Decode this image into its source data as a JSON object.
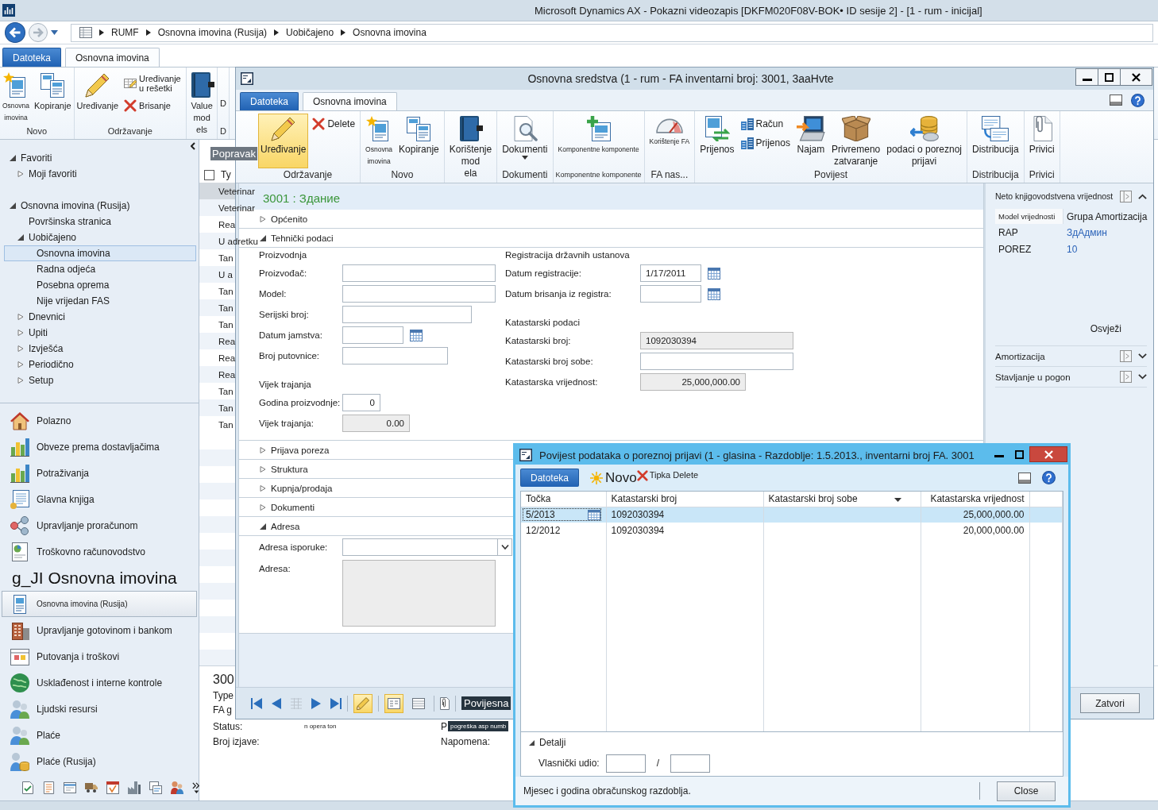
{
  "window": {
    "title": "Microsoft Dynamics AX - Pokazni videozapis [DKFM020F08V-BOK• ID sesije 2] - [1 - rum - inicijal]"
  },
  "address_bar": {
    "breadcrumb": [
      "RUMF",
      "Osnovna imovina (Rusija)",
      "Uobičajeno",
      "Osnovna imovina"
    ]
  },
  "ribbon": {
    "tabs": [
      {
        "label": "Datoteka",
        "kind": "file",
        "selected": false
      },
      {
        "label": "Osnovna imovina",
        "kind": "tab",
        "selected": true
      }
    ],
    "groups": [
      {
        "label": "Novo",
        "buttons": [
          {
            "kind": "compact",
            "label": "Osnovna\nimovina"
          },
          {
            "kind": "large",
            "label": "Kopiranje"
          }
        ]
      },
      {
        "label": "Održavanje",
        "buttons": [
          {
            "kind": "large",
            "label": "Uređivanje"
          },
          {
            "kind": "small",
            "label": "Uređivanje u rešetki"
          },
          {
            "kind": "small",
            "label": "Brisanje"
          }
        ]
      },
      {
        "buttons": [
          {
            "kind": "large",
            "label": "Value\nmod\nels"
          }
        ]
      },
      {
        "label": "D",
        "buttons": [
          {
            "kind": "large",
            "label": "D"
          }
        ]
      }
    ]
  },
  "navigation": {
    "tree": [
      {
        "label": "Favoriti",
        "expanded": true,
        "selected": false,
        "children": [
          {
            "label": "Moji favoriti",
            "expanded": false,
            "selected": false
          }
        ]
      },
      {
        "label": "Osnovna imovina (Rusija)",
        "expanded": true,
        "selected": false,
        "children": [
          {
            "label": "Površinska stranica",
            "selected": false
          },
          {
            "label": "Uobičajeno",
            "expanded": true,
            "selected": false,
            "children": [
              {
                "label": "Osnovna imovina",
                "selected": true
              },
              {
                "label": "Radna odjeća",
                "selected": false
              },
              {
                "label": "Posebna oprema",
                "selected": false
              },
              {
                "label": "Nije vrijedan FAS",
                "selected": false
              }
            ]
          },
          {
            "label": "Dnevnici",
            "expanded": false,
            "selected": false
          },
          {
            "label": "Upiti",
            "expanded": false,
            "selected": false
          },
          {
            "label": "Izvješća",
            "expanded": false,
            "selected": false
          },
          {
            "label": "Periodično",
            "expanded": false,
            "selected": false
          },
          {
            "label": "Setup",
            "expanded": false,
            "selected": false
          }
        ]
      }
    ],
    "modules": [
      {
        "kind": "module",
        "label": "Polazno",
        "selected": false
      },
      {
        "kind": "module",
        "label": "Obveze prema dostavljačima",
        "selected": false
      },
      {
        "kind": "module",
        "label": "Potraživanja",
        "selected": false
      },
      {
        "kind": "module",
        "label": "Glavna knjiga",
        "selected": false
      },
      {
        "kind": "module",
        "label": "Upravljanje proračunom",
        "selected": false
      },
      {
        "kind": "module",
        "label": "Troškovno računovodstvo",
        "selected": false
      },
      {
        "kind": "heading",
        "label": "g_JI Osnovna imovina"
      },
      {
        "kind": "module",
        "label": "Osnovna imovina (Rusija)",
        "selected": true
      },
      {
        "kind": "module",
        "label": "Upravljanje gotovinom i bankom",
        "selected": false
      },
      {
        "kind": "module",
        "label": "Putovanja i troškovi",
        "selected": false
      },
      {
        "kind": "module",
        "label": "Usklađenost i interne kontrole",
        "selected": false
      },
      {
        "kind": "module",
        "label": "Ljudski resursi",
        "selected": false
      },
      {
        "kind": "module",
        "label": "Plaće",
        "selected": false
      },
      {
        "kind": "module",
        "label": "Plaće (Rusija)",
        "selected": false
      }
    ]
  },
  "list_page": {
    "filter": "Popravak",
    "header": {
      "checked": false,
      "column": "Ty"
    },
    "rows": [
      {
        "text": "Veterinar",
        "selected": true
      },
      {
        "text": "Veterinar",
        "selected": false
      },
      {
        "text": "Rea",
        "selected": false
      },
      {
        "text": "U adretku",
        "selected": false
      },
      {
        "text": "Tan",
        "selected": false
      },
      {
        "text": "U a",
        "selected": false
      },
      {
        "text": "Tan",
        "selected": false
      },
      {
        "text": "Tan",
        "selected": false
      },
      {
        "text": "Tan",
        "selected": false
      },
      {
        "text": "Rea",
        "selected": false
      },
      {
        "text": "Rea",
        "selected": false
      },
      {
        "text": "Rea",
        "selected": false
      },
      {
        "text": "Tan",
        "selected": false
      },
      {
        "text": "Tan",
        "selected": false
      },
      {
        "text": "Tan",
        "selected": false
      }
    ],
    "details": {
      "title": "300",
      "lines": [
        "Type",
        "FA g"
      ],
      "fields": [
        {
          "label": "Status:",
          "value": "n opera ton",
          "kind": "plain"
        },
        {
          "label": "P",
          "value": "pogreška asp numb",
          "kind": "tag"
        },
        {
          "label": "Broj izjave:"
        },
        {
          "label": "Napomena:"
        }
      ]
    }
  },
  "asset_form": {
    "title": "Osnovna sredstva (1 - rum - FA inventarni broj: 3001, 3aaHvte",
    "ribbon": {
      "tabs": [
        {
          "label": "Datoteka",
          "kind": "file",
          "selected": false
        },
        {
          "label": "Osnovna imovina",
          "kind": "tab",
          "selected": true
        }
      ],
      "groups": [
        {
          "label": "Održavanje",
          "buttons": [
            {
              "kind": "large",
              "label": "Uređivanje",
              "on": true
            },
            {
              "kind": "small",
              "label": "Delete",
              "on": false
            }
          ]
        },
        {
          "label": "Novo",
          "buttons": [
            {
              "kind": "compact",
              "label": "Osnovna\nimovina"
            },
            {
              "kind": "large",
              "label": "Kopiranje"
            }
          ]
        },
        {
          "buttons": [
            {
              "kind": "large",
              "label": "Korištenje\nmod\nela"
            }
          ]
        },
        {
          "label": "Dokumenti",
          "buttons": [
            {
              "kind": "menu",
              "label": "Dokumenti"
            }
          ]
        },
        {
          "label": "Komponentne komponente",
          "buttons": [
            {
              "kind": "compact",
              "label": "Komponentne komponente"
            }
          ]
        },
        {
          "label": "FA nas...",
          "buttons": [
            {
              "kind": "compact",
              "label": "Korištenje FA"
            }
          ]
        },
        {
          "label": "Povijest",
          "buttons": [
            {
              "kind": "large",
              "label": "Prijenos"
            },
            {
              "kind": "small",
              "label": "Račun"
            },
            {
              "kind": "small",
              "label": "Prijenos"
            },
            {
              "kind": "large",
              "label": "Najam"
            },
            {
              "kind": "large",
              "label": "Privremeno\nzatvaranje"
            },
            {
              "kind": "large",
              "label": "podaci o poreznoj\nprijavi"
            }
          ]
        },
        {
          "label": "Distribucija",
          "buttons": [
            {
              "kind": "large",
              "label": "Distribucija"
            }
          ]
        },
        {
          "label": "Privici",
          "buttons": [
            {
              "kind": "large",
              "label": "Privici"
            }
          ]
        }
      ]
    },
    "header": "3001 : Здание",
    "sections": [
      {
        "title": "Općenito",
        "expanded": false
      },
      {
        "title": "Tehnički podaci",
        "expanded": true,
        "columns": [
          [
            {
              "title": "Proizvodnja",
              "fields": [
                {
                  "label": "Proizvođač:",
                  "kind": "text",
                  "editable": true
                },
                {
                  "label": "Model:",
                  "kind": "text",
                  "editable": true
                },
                {
                  "label": "Serijski broj:",
                  "kind": "text",
                  "editable": true
                },
                {
                  "label": "Datum jamstva:",
                  "kind": "date",
                  "editable": true
                },
                {
                  "label": "Broj putovnice:",
                  "kind": "text",
                  "editable": true
                }
              ]
            },
            {
              "title": "Vijek trajanja",
              "fields": [
                {
                  "label": "Godina proizvodnje:",
                  "kind": "number",
                  "editable": true,
                  "value": "0"
                },
                {
                  "label": "Vijek trajanja:",
                  "kind": "number",
                  "editable": false,
                  "value": "0.00"
                }
              ]
            }
          ],
          [
            {
              "title": "Registracija državnih ustanova",
              "fields": [
                {
                  "label": "Datum registracije:",
                  "kind": "date",
                  "editable": true,
                  "value": "1/17/2011"
                },
                {
                  "label": "Datum brisanja iz registra:",
                  "kind": "date",
                  "editable": true
                }
              ]
            },
            {
              "title": "Katastarski podaci",
              "fields": [
                {
                  "label": "Katastarski broj:",
                  "kind": "text",
                  "editable": false,
                  "value": "1092030394"
                },
                {
                  "label": "Katastarski broj sobe:",
                  "kind": "text",
                  "editable": true
                },
                {
                  "label": "Katastarska vrijednost:",
                  "kind": "number",
                  "editable": false,
                  "value": "25,000,000.00"
                }
              ]
            }
          ]
        ]
      },
      {
        "title": "Prijava poreza",
        "expanded": false
      },
      {
        "title": "Struktura",
        "expanded": false
      },
      {
        "title": "Kupnja/prodaja",
        "expanded": false
      },
      {
        "title": "Dokumenti",
        "expanded": false
      },
      {
        "title": "Adresa",
        "expanded": true,
        "fields": [
          {
            "label": "Adresa isporuke:",
            "kind": "dropdown",
            "editable": true
          },
          {
            "label": "Adresa:",
            "kind": "textarea",
            "editable": false
          }
        ]
      }
    ],
    "factboxes": [
      {
        "title": "Neto knjigovodstvena vrijednost",
        "expanded": true,
        "columns": [
          "Model vrijednosti",
          "Grupa Amortizacija"
        ],
        "rows": [
          [
            "RAP",
            "ЗдАдмин"
          ],
          [
            "POREZ",
            "10"
          ]
        ],
        "action": "Osvježi"
      },
      {
        "title": "Amortizacija",
        "expanded": false
      },
      {
        "title": "Stavljanje u pogon",
        "expanded": false
      }
    ],
    "toolbar": {
      "edit_mode": true,
      "views": [
        {
          "selected": true
        },
        {
          "selected": false
        }
      ],
      "tag": "Povijesna",
      "close_button": "Zatvori"
    }
  },
  "tax_history_dialog": {
    "title": "Povijest podataka o poreznoj prijavi (1 - glasina - Razdoblje: 1.5.2013., inventarni broj FA. 3001",
    "toolbar": {
      "file_tab": "Datoteka",
      "buttons": [
        {
          "kind": "new",
          "label": "Novo"
        },
        {
          "kind": "delete",
          "label": "Tipka Delete"
        }
      ]
    },
    "grid": {
      "columns": [
        {
          "label": "Točka",
          "kind": "date",
          "sorted": false
        },
        {
          "label": "Katastarski broj",
          "kind": "text",
          "sorted": false
        },
        {
          "label": "Katastarski broj sobe",
          "kind": "text",
          "sorted": true
        },
        {
          "label": "Katastarska vrijednost",
          "kind": "amount",
          "sorted": false
        }
      ],
      "rows": [
        {
          "selected": true,
          "period": "5/2013",
          "cadastral_number": "1092030394",
          "cadastral_value": "25,000,000.00"
        },
        {
          "selected": false,
          "period": "12/2012",
          "cadastral_number": "1092030394",
          "cadastral_value": "20,000,000.00"
        }
      ]
    },
    "details": {
      "title": "Detalji",
      "expanded": true,
      "field": {
        "label": "Vlasnički udio:",
        "separator": "/"
      }
    },
    "status": "Mjesec i godina obračunskog razdoblja.",
    "close_button": "Close"
  }
}
